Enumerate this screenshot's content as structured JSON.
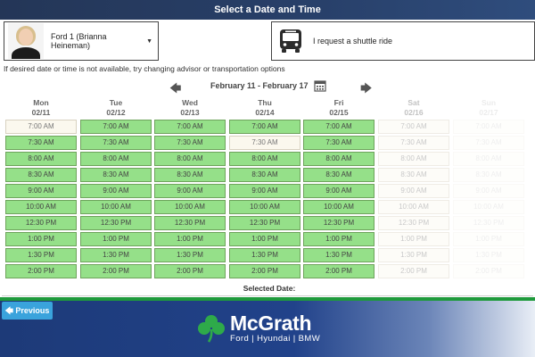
{
  "header": {
    "title": "Select a Date and Time"
  },
  "advisor": {
    "name": "Ford 1 (Brianna Heineman)"
  },
  "transport": {
    "label": "I request a shuttle ride"
  },
  "hint": "If desired date or time is not available, try changing advisor or transportation options",
  "week": {
    "range": "February 11 - February 17"
  },
  "times": [
    "7:00 AM",
    "7:30 AM",
    "8:00 AM",
    "8:30 AM",
    "9:00 AM",
    "10:00 AM",
    "12:30 PM",
    "1:00 PM",
    "1:30 PM",
    "2:00 PM"
  ],
  "days": [
    {
      "day": "Mon",
      "date": "02/11",
      "state": "normal",
      "available": [
        false,
        true,
        true,
        true,
        true,
        true,
        true,
        true,
        true,
        true
      ]
    },
    {
      "day": "Tue",
      "date": "02/12",
      "state": "normal",
      "available": [
        true,
        true,
        true,
        true,
        true,
        true,
        true,
        true,
        true,
        true
      ]
    },
    {
      "day": "Wed",
      "date": "02/13",
      "state": "normal",
      "available": [
        true,
        true,
        true,
        true,
        true,
        true,
        true,
        true,
        true,
        true
      ]
    },
    {
      "day": "Thu",
      "date": "02/14",
      "state": "normal",
      "available": [
        true,
        false,
        true,
        true,
        true,
        true,
        true,
        true,
        true,
        true
      ]
    },
    {
      "day": "Fri",
      "date": "02/15",
      "state": "normal",
      "available": [
        true,
        true,
        true,
        true,
        true,
        true,
        true,
        true,
        true,
        true
      ]
    },
    {
      "day": "Sat",
      "date": "02/16",
      "state": "dim",
      "available": [
        false,
        false,
        false,
        false,
        false,
        false,
        false,
        false,
        false,
        false
      ]
    },
    {
      "day": "Sun",
      "date": "02/17",
      "state": "faint",
      "available": [
        false,
        false,
        false,
        false,
        false,
        false,
        false,
        false,
        false,
        false
      ]
    }
  ],
  "selected_label": "Selected Date:",
  "nav": {
    "previous_label": "Previous"
  },
  "footer": {
    "brand": "McGrath",
    "sub": "Ford | Hyundai | BMW"
  },
  "colors": {
    "available": "#95e089",
    "unavailable": "#fbf8ee",
    "header_bg": "#243657",
    "button": "#3aa3dc",
    "brand_green": "#1f9a3c"
  }
}
